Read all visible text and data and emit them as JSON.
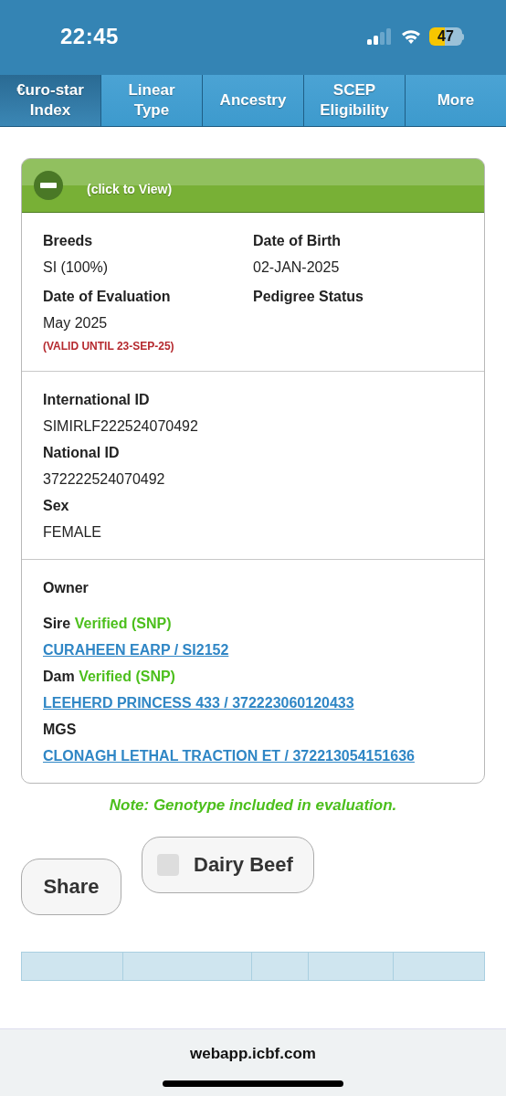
{
  "status_bar": {
    "time": "22:45",
    "battery": "47"
  },
  "tabs": [
    {
      "label": "€uro-star\nIndex",
      "selected": true
    },
    {
      "label": "Linear\nType",
      "selected": false
    },
    {
      "label": "Ancestry",
      "selected": false
    },
    {
      "label": "SCEP\nEligibility",
      "selected": false
    },
    {
      "label": "More",
      "selected": false
    }
  ],
  "card": {
    "header": "(click to View)",
    "expanded": true,
    "details": [
      {
        "label": "Breeds",
        "value": "SI (100%)"
      },
      {
        "label": "Date of Birth",
        "value": "02-JAN-2025"
      },
      {
        "label": "Date of Evaluation",
        "value": "May 2025",
        "note": "(VALID UNTIL 23-SEP-25)"
      },
      {
        "label": "Pedigree Status"
      }
    ],
    "ids": [
      {
        "label": "International ID",
        "value": "SIMIRLF222524070492"
      },
      {
        "label": "National ID",
        "value": "372222524070492"
      },
      {
        "label": "Sex",
        "value": "FEMALE"
      }
    ],
    "owner": "Owner",
    "parentage": [
      {
        "label": "Sire",
        "status": "Verified (SNP)",
        "link": "CURAHEEN EARP / SI2152"
      },
      {
        "label": "Dam",
        "status": "Verified (SNP)",
        "link": "LEEHERD PRINCESS 433 / 372223060120433"
      },
      {
        "label": "MGS",
        "link": "CLONAGH LETHAL TRACTION ET / 372213054151636"
      }
    ]
  },
  "note": "Note: Genotype included in evaluation.",
  "share_button": "Share",
  "dairy_beef": {
    "label": "Dairy Beef",
    "checked": false
  },
  "browser": {
    "url": "webapp.icbf.com"
  }
}
